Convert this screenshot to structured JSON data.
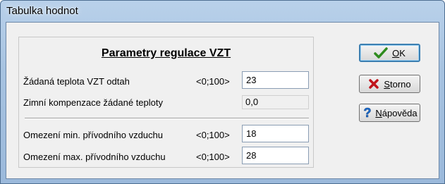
{
  "window": {
    "title": "Tabulka hodnot"
  },
  "group": {
    "heading": "Parametry regulace VZT",
    "rows": [
      {
        "label": "Žádaná teplota VZT odtah",
        "range": "<0;100>",
        "value": "23"
      },
      {
        "label": "Zimní kompenzace žádané teploty",
        "range": "",
        "value": "0,0"
      },
      {
        "label": "Omezení min. přívodního vzduchu",
        "range": "<0;100>",
        "value": "18"
      },
      {
        "label": "Omezení max. přívodního vzduchu",
        "range": "<0;100>",
        "value": "28"
      }
    ]
  },
  "buttons": {
    "ok": {
      "label": "OK",
      "mnemonic": "O",
      "rest": "K",
      "icon": "checkmark-icon",
      "color": "#2e8b1e"
    },
    "cancel": {
      "label": "Storno",
      "mnemonic": "S",
      "rest": "torno",
      "icon": "x-icon",
      "color": "#c0141c"
    },
    "help": {
      "label": "Nápověda",
      "mnemonic": "N",
      "rest": "ápověda",
      "icon": "question-icon",
      "color": "#1c6fd1"
    }
  }
}
